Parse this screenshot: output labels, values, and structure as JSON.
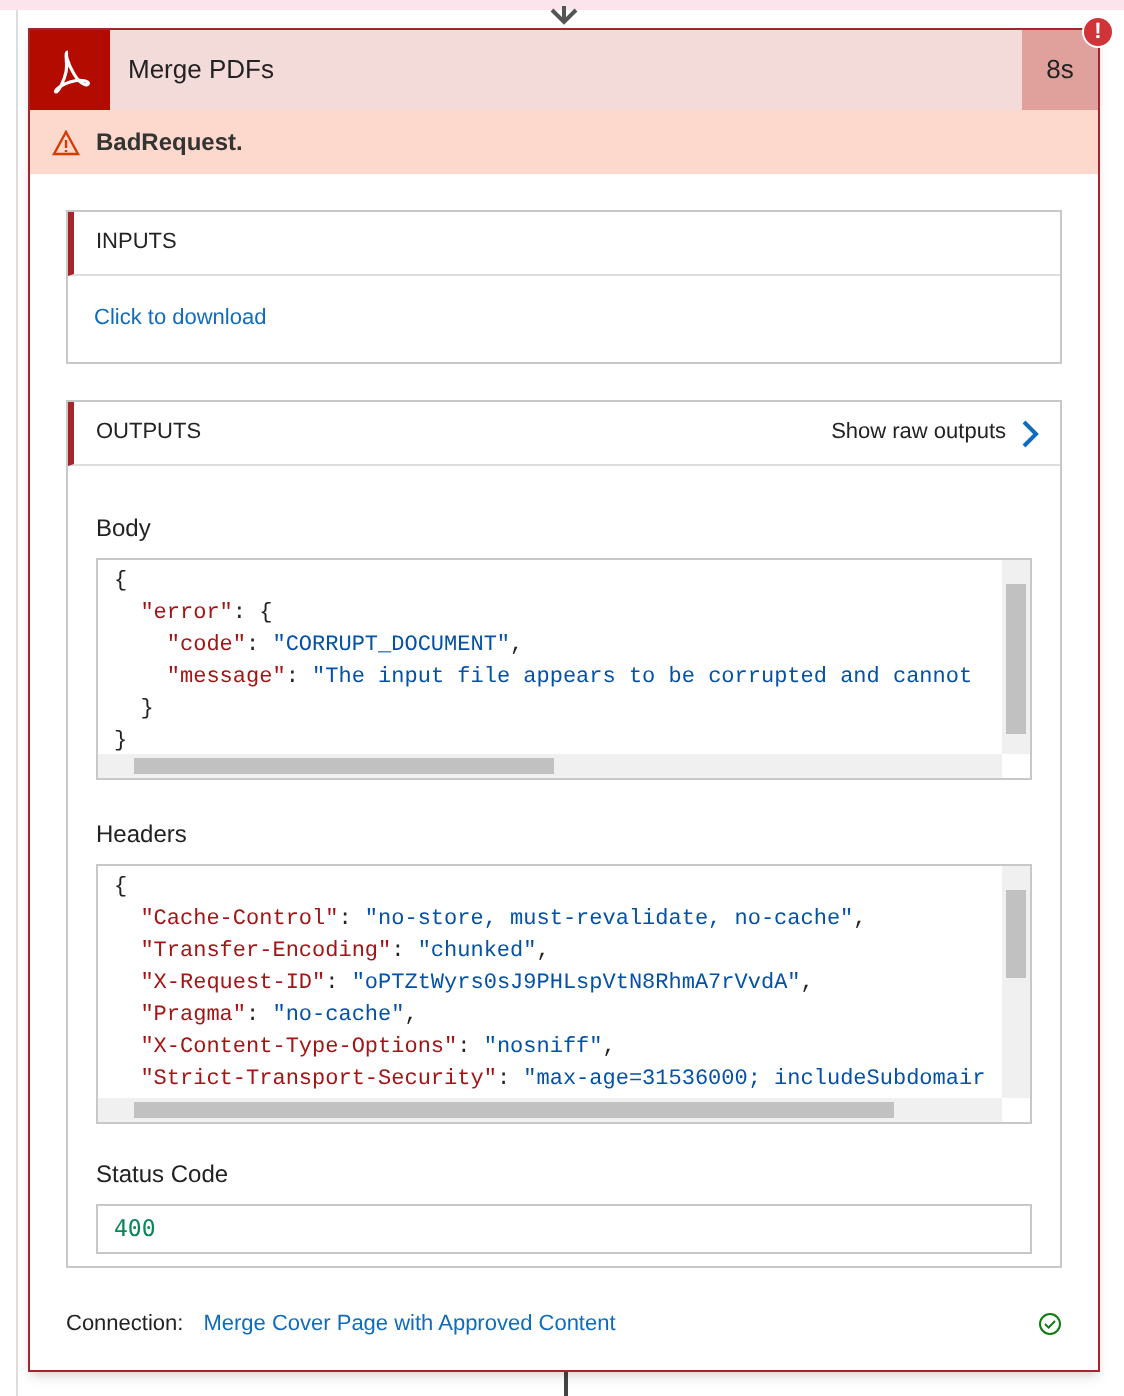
{
  "action": {
    "title": "Merge PDFs",
    "duration": "8s",
    "error_badge": "!",
    "error_message": "BadRequest."
  },
  "inputs": {
    "title": "INPUTS",
    "link": "Click to download"
  },
  "outputs": {
    "title": "OUTPUTS",
    "raw_link": "Show raw outputs",
    "body": {
      "label": "Body",
      "lines": [
        [
          {
            "kind": "punct",
            "text": "{"
          }
        ],
        [
          {
            "kind": "key",
            "text": "  \"error\""
          },
          {
            "kind": "punct",
            "text": ": {"
          }
        ],
        [
          {
            "kind": "key",
            "text": "    \"code\""
          },
          {
            "kind": "punct",
            "text": ": "
          },
          {
            "kind": "str",
            "text": "\"CORRUPT_DOCUMENT\""
          },
          {
            "kind": "punct",
            "text": ","
          }
        ],
        [
          {
            "kind": "key",
            "text": "    \"message\""
          },
          {
            "kind": "punct",
            "text": ": "
          },
          {
            "kind": "str",
            "text": "\"The input file appears to be corrupted and cannot"
          }
        ],
        [
          {
            "kind": "punct",
            "text": "  }"
          }
        ],
        [
          {
            "kind": "punct",
            "text": "}"
          }
        ]
      ]
    },
    "headers": {
      "label": "Headers",
      "lines": [
        [
          {
            "kind": "punct",
            "text": "{"
          }
        ],
        [
          {
            "kind": "key",
            "text": "  \"Cache-Control\""
          },
          {
            "kind": "punct",
            "text": ": "
          },
          {
            "kind": "str",
            "text": "\"no-store, must-revalidate, no-cache\""
          },
          {
            "kind": "punct",
            "text": ","
          }
        ],
        [
          {
            "kind": "key",
            "text": "  \"Transfer-Encoding\""
          },
          {
            "kind": "punct",
            "text": ": "
          },
          {
            "kind": "str",
            "text": "\"chunked\""
          },
          {
            "kind": "punct",
            "text": ","
          }
        ],
        [
          {
            "kind": "key",
            "text": "  \"X-Request-ID\""
          },
          {
            "kind": "punct",
            "text": ": "
          },
          {
            "kind": "str",
            "text": "\"oPTZtWyrs0sJ9PHLspVtN8RhmA7rVvdA\""
          },
          {
            "kind": "punct",
            "text": ","
          }
        ],
        [
          {
            "kind": "key",
            "text": "  \"Pragma\""
          },
          {
            "kind": "punct",
            "text": ": "
          },
          {
            "kind": "str",
            "text": "\"no-cache\""
          },
          {
            "kind": "punct",
            "text": ","
          }
        ],
        [
          {
            "kind": "key",
            "text": "  \"X-Content-Type-Options\""
          },
          {
            "kind": "punct",
            "text": ": "
          },
          {
            "kind": "str",
            "text": "\"nosniff\""
          },
          {
            "kind": "punct",
            "text": ","
          }
        ],
        [
          {
            "kind": "key",
            "text": "  \"Strict-Transport-Security\""
          },
          {
            "kind": "punct",
            "text": ": "
          },
          {
            "kind": "str",
            "text": "\"max-age=31536000; includeSubdomair"
          }
        ]
      ]
    },
    "status": {
      "label": "Status Code",
      "value": "400"
    }
  },
  "connection": {
    "label": "Connection:",
    "link": "Merge Cover Page with Approved Content",
    "ok": true
  }
}
